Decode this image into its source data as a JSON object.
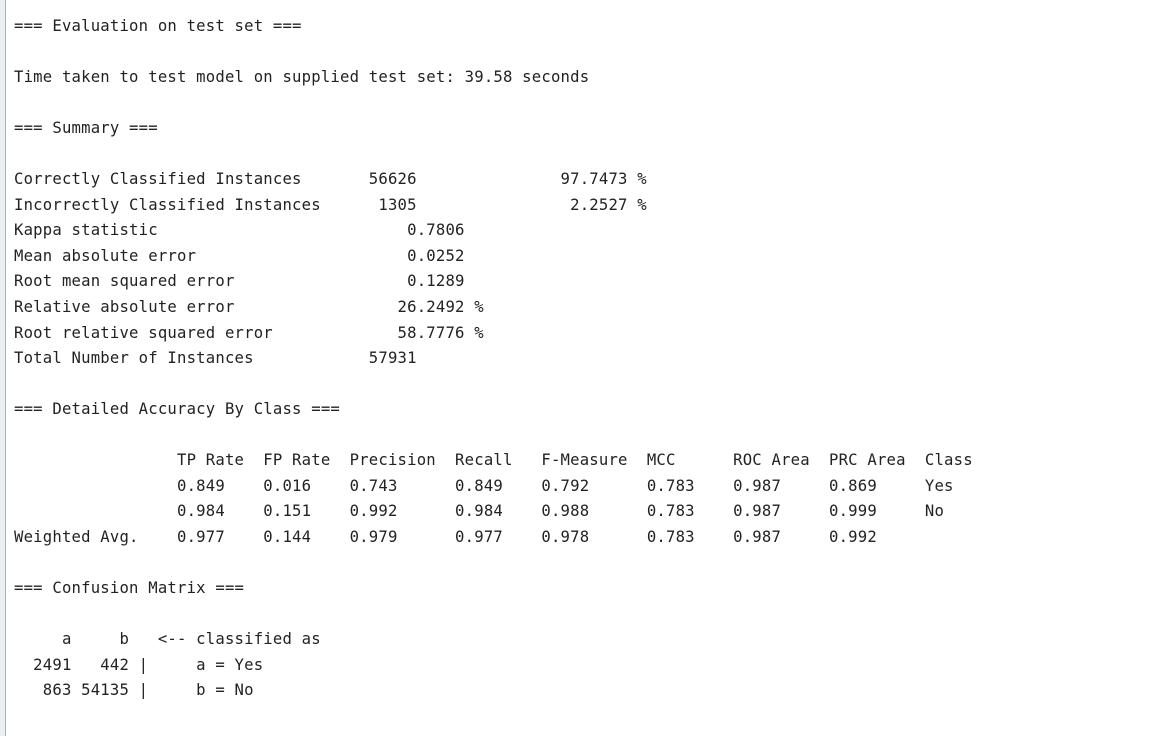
{
  "lines": [
    "=== Evaluation on test set ===",
    "",
    "Time taken to test model on supplied test set: 39.58 seconds",
    "",
    "=== Summary ===",
    "",
    "Correctly Classified Instances       56626               97.7473 %",
    "Incorrectly Classified Instances      1305                2.2527 %",
    "Kappa statistic                          0.7806",
    "Mean absolute error                      0.0252",
    "Root mean squared error                  0.1289",
    "Relative absolute error                 26.2492 %",
    "Root relative squared error             58.7776 %",
    "Total Number of Instances            57931",
    "",
    "=== Detailed Accuracy By Class ===",
    "",
    "                 TP Rate  FP Rate  Precision  Recall   F-Measure  MCC      ROC Area  PRC Area  Class",
    "                 0.849    0.016    0.743      0.849    0.792      0.783    0.987     0.869     Yes",
    "                 0.984    0.151    0.992      0.984    0.988      0.783    0.987     0.999     No",
    "Weighted Avg.    0.977    0.144    0.979      0.977    0.978      0.783    0.987     0.992",
    "",
    "=== Confusion Matrix ===",
    "",
    "     a     b   <-- classified as",
    "  2491   442 |     a = Yes",
    "   863 54135 |     b = No"
  ]
}
